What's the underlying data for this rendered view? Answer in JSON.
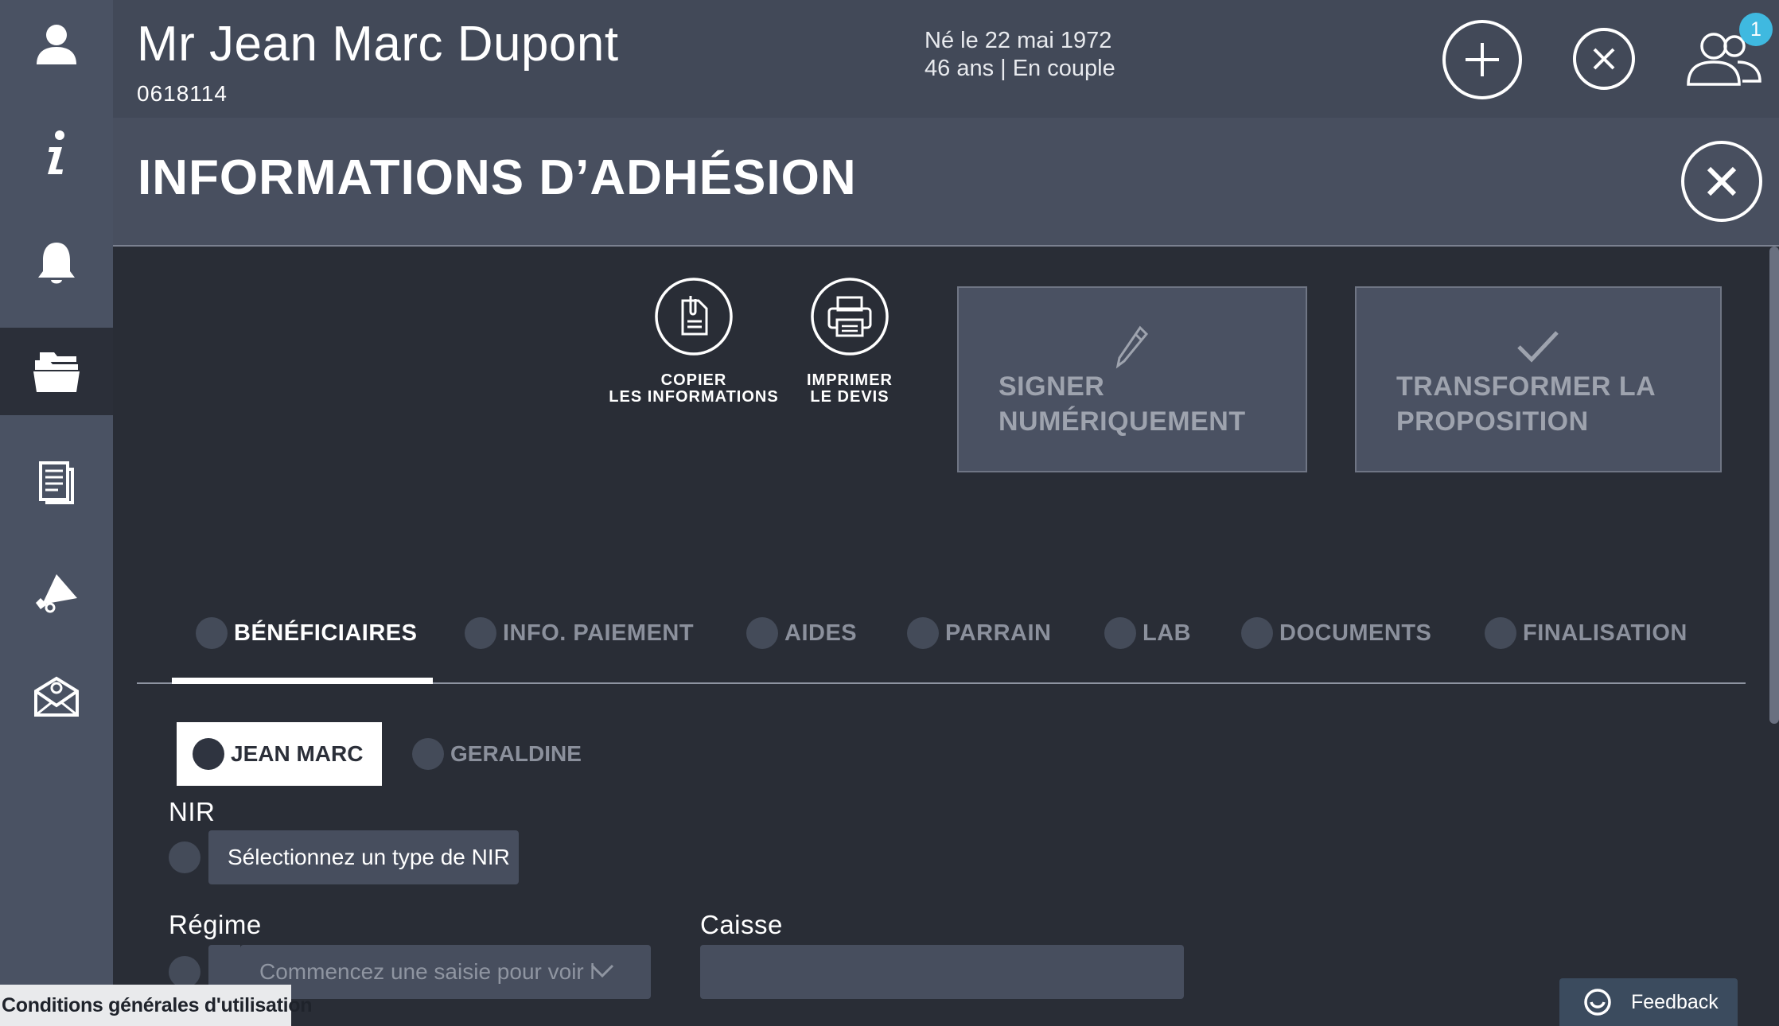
{
  "header": {
    "client_name": "Mr Jean Marc Dupont",
    "client_id": "0618114",
    "birth_line": "Né le 22 mai 1972",
    "status_line": "46 ans | En couple",
    "notifications_count": "1"
  },
  "sidebar": {
    "items": [
      {
        "icon": "user-icon"
      },
      {
        "icon": "info-icon"
      },
      {
        "icon": "bell-icon"
      },
      {
        "icon": "folders-icon",
        "active": true
      },
      {
        "icon": "document-icon"
      },
      {
        "icon": "megaphone-icon"
      },
      {
        "icon": "email-icon"
      }
    ]
  },
  "page": {
    "title": "INFORMATIONS D’ADHÉSION"
  },
  "actions": {
    "copy_line1": "COPIER",
    "copy_line2": "LES INFORMATIONS",
    "print_line1": "IMPRIMER",
    "print_line2": "LE DEVIS",
    "sign_line1": "SIGNER",
    "sign_line2": "NUMÉRIQUEMENT",
    "transform_line1": "TRANSFORMER LA",
    "transform_line2": "PROPOSITION"
  },
  "tabs": [
    {
      "label": "BÉNÉFICIAIRES",
      "active": true
    },
    {
      "label": "INFO. PAIEMENT"
    },
    {
      "label": "AIDES"
    },
    {
      "label": "PARRAIN"
    },
    {
      "label": "LAB"
    },
    {
      "label": "DOCUMENTS"
    },
    {
      "label": "FINALISATION"
    }
  ],
  "persons": [
    {
      "label": "JEAN MARC",
      "active": true
    },
    {
      "label": "GERALDINE"
    }
  ],
  "form": {
    "nir_label": "NIR",
    "nir_value": "Sélectionnez un type de NIR",
    "regime_label": "Régime",
    "regime_placeholder": "Commencez une saisie pour voir la liste",
    "caisse_label": "Caisse",
    "caisse_value": ""
  },
  "footer": {
    "cgu_label": "Conditions générales d'utilisation",
    "feedback_label": "Feedback"
  },
  "colors": {
    "sidebar": "#4a5263",
    "header": "#424958",
    "content_bg": "#292d36",
    "badge": "#3fb9e0"
  }
}
